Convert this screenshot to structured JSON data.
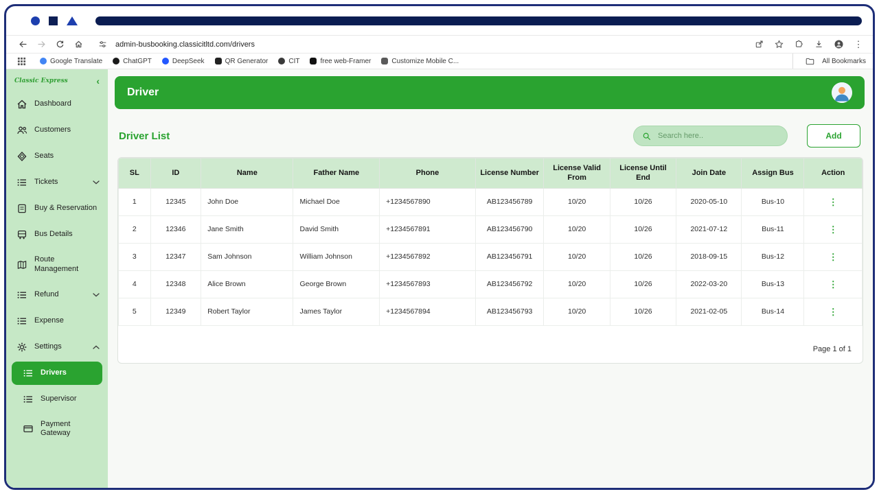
{
  "colors": {
    "primary_green": "#2aa330",
    "sidebar_bg": "#c6e8c6",
    "table_header_bg": "#cfeacf",
    "search_bg": "#bfe4c2",
    "frame_navy": "#1e2e78"
  },
  "browser": {
    "url": "admin-busbooking.classicitltd.com/drivers",
    "bookmarks": [
      {
        "label": "Google Translate",
        "favicon": "translate-favicon",
        "color": "#4285f4",
        "shape": "round"
      },
      {
        "label": "ChatGPT",
        "favicon": "chatgpt-favicon",
        "color": "#1a1a1a",
        "shape": "round"
      },
      {
        "label": "DeepSeek",
        "favicon": "deepseek-favicon",
        "color": "#2458ff",
        "shape": "round"
      },
      {
        "label": "QR Generator",
        "favicon": "qr-favicon",
        "color": "#222222",
        "shape": "square"
      },
      {
        "label": "CIT",
        "favicon": "cit-favicon",
        "color": "#3a3a3a",
        "shape": "round"
      },
      {
        "label": "free web-Framer",
        "favicon": "framer-favicon",
        "color": "#111111",
        "shape": "square"
      },
      {
        "label": "Customize Mobile C...",
        "favicon": "customize-favicon",
        "color": "#5a5a5a",
        "shape": "square"
      }
    ],
    "all_bookmarks_label": "All Bookmarks"
  },
  "sidebar": {
    "logo": "Classic Express",
    "items": [
      {
        "label": "Dashboard",
        "icon": "home"
      },
      {
        "label": "Customers",
        "icon": "users"
      },
      {
        "label": "Seats",
        "icon": "seat"
      },
      {
        "label": "Tickets",
        "icon": "list",
        "expandable": true
      },
      {
        "label": "Buy & Reservation",
        "icon": "reservation"
      },
      {
        "label": "Bus Details",
        "icon": "bus"
      },
      {
        "label": "Route Management",
        "icon": "route"
      },
      {
        "label": "Refund",
        "icon": "list",
        "expandable": true
      },
      {
        "label": "Expense",
        "icon": "list"
      },
      {
        "label": "Settings",
        "icon": "gear",
        "expandable": true,
        "expanded": true
      }
    ],
    "settings_children": [
      {
        "label": "Drivers",
        "icon": "list",
        "active": true
      },
      {
        "label": "Supervisor",
        "icon": "list"
      },
      {
        "label": "Payment Gateway",
        "icon": "card"
      }
    ]
  },
  "header": {
    "title": "Driver"
  },
  "main": {
    "list_title": "Driver List",
    "search_placeholder": "Search here..",
    "add_label": "Add",
    "pagination": "Page 1 of 1",
    "table": {
      "columns": [
        "SL",
        "ID",
        "Name",
        "Father Name",
        "Phone",
        "License Number",
        "License Valid From",
        "License Until End",
        "Join Date",
        "Assign Bus",
        "Action"
      ],
      "rows": [
        [
          "1",
          "12345",
          "John Doe",
          "Michael Doe",
          "+1234567890",
          "AB123456789",
          "10/20",
          "10/26",
          "2020-05-10",
          "Bus-10"
        ],
        [
          "2",
          "12346",
          "Jane Smith",
          "David Smith",
          "+1234567891",
          "AB123456790",
          "10/20",
          "10/26",
          "2021-07-12",
          "Bus-11"
        ],
        [
          "3",
          "12347",
          "Sam Johnson",
          "William Johnson",
          "+1234567892",
          "AB123456791",
          "10/20",
          "10/26",
          "2018-09-15",
          "Bus-12"
        ],
        [
          "4",
          "12348",
          "Alice Brown",
          "George Brown",
          "+1234567893",
          "AB123456792",
          "10/20",
          "10/26",
          "2022-03-20",
          "Bus-13"
        ],
        [
          "5",
          "12349",
          "Robert Taylor",
          "James Taylor",
          "+1234567894",
          "AB123456793",
          "10/20",
          "10/26",
          "2021-02-05",
          "Bus-14"
        ]
      ]
    }
  }
}
